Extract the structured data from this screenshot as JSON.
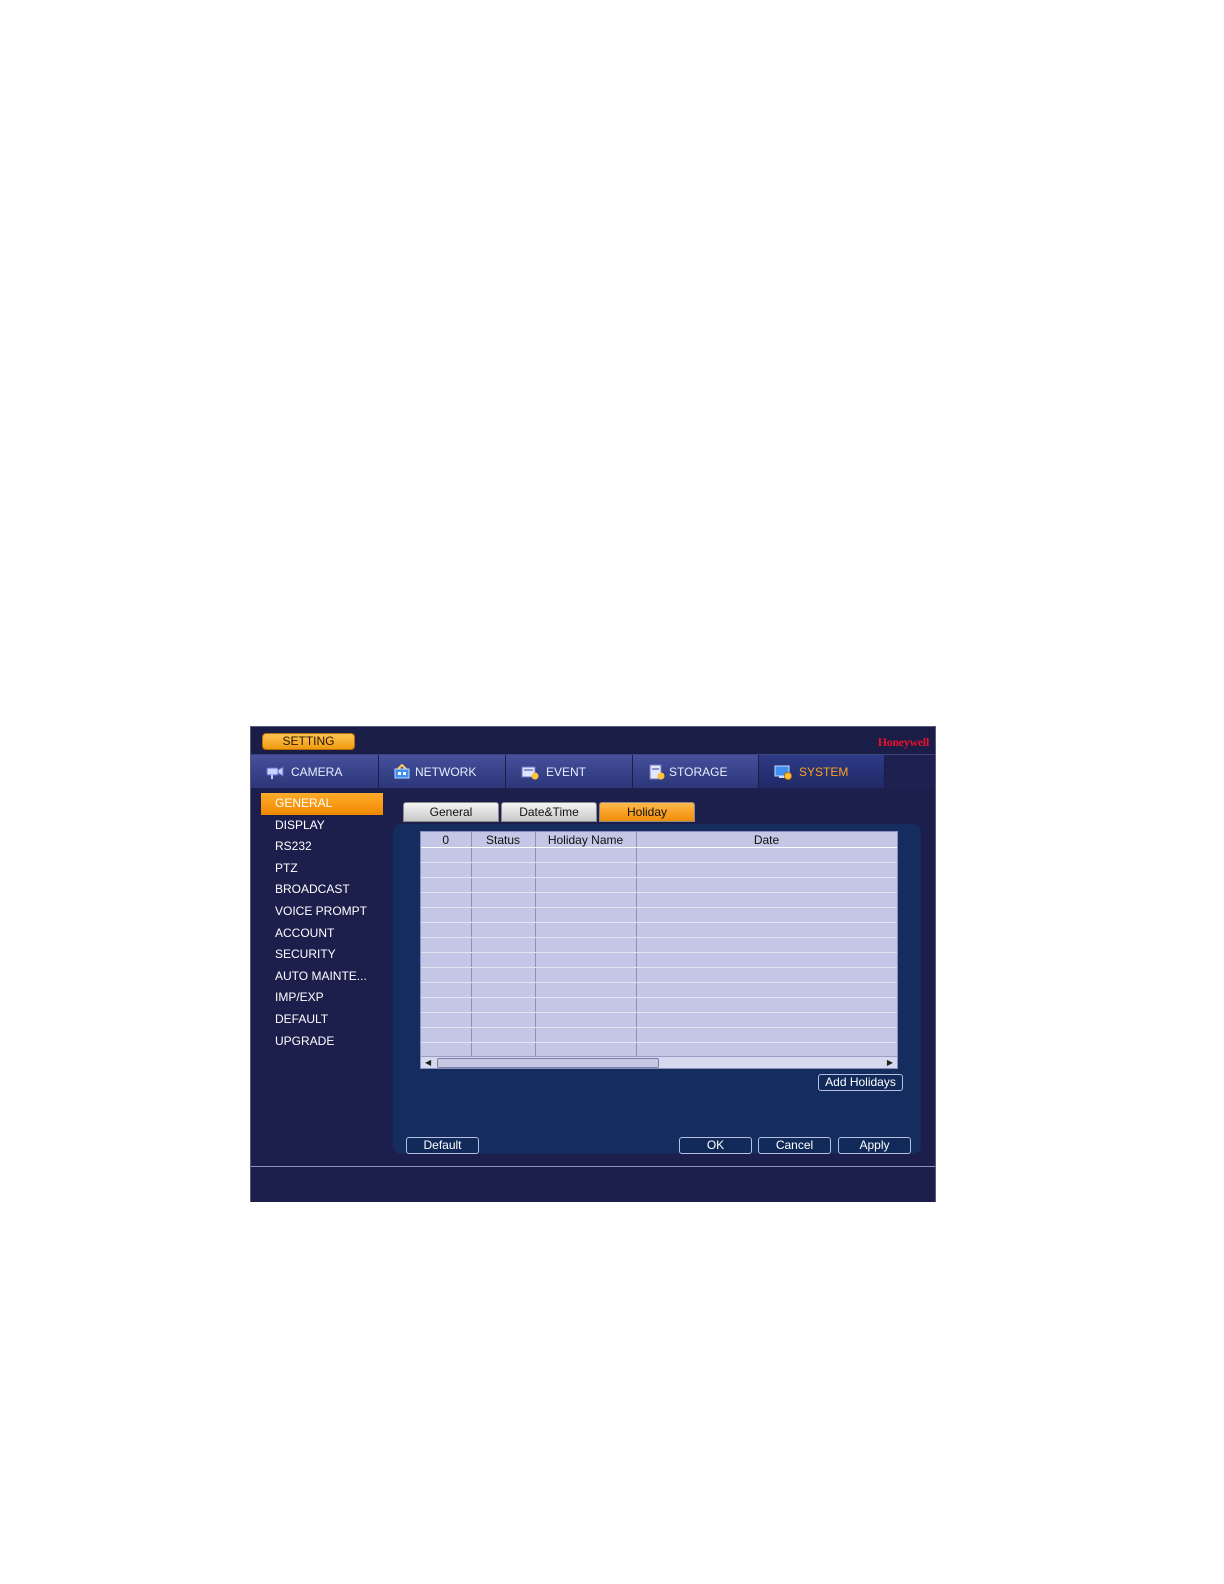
{
  "titlebar": {
    "setting_label": "SETTING",
    "brand": "Honeywell"
  },
  "main_tabs": [
    {
      "label": "CAMERA",
      "icon": "camera-icon"
    },
    {
      "label": "NETWORK",
      "icon": "network-icon"
    },
    {
      "label": "EVENT",
      "icon": "event-icon"
    },
    {
      "label": "STORAGE",
      "icon": "storage-icon"
    },
    {
      "label": "SYSTEM",
      "icon": "system-icon"
    }
  ],
  "sidebar": {
    "items": [
      {
        "label": "GENERAL"
      },
      {
        "label": "DISPLAY"
      },
      {
        "label": "RS232"
      },
      {
        "label": "PTZ"
      },
      {
        "label": "BROADCAST"
      },
      {
        "label": "VOICE PROMPT"
      },
      {
        "label": "ACCOUNT"
      },
      {
        "label": "SECURITY"
      },
      {
        "label": "AUTO MAINTE..."
      },
      {
        "label": "IMP/EXP"
      },
      {
        "label": "DEFAULT"
      },
      {
        "label": "UPGRADE"
      }
    ]
  },
  "sub_tabs": [
    {
      "label": "General"
    },
    {
      "label": "Date&Time"
    },
    {
      "label": "Holiday"
    }
  ],
  "holiday_table": {
    "headers": [
      "0",
      "Status",
      "Holiday Name",
      "Date"
    ]
  },
  "buttons": {
    "add_holidays": "Add Holidays",
    "default": "Default",
    "ok": "OK",
    "cancel": "Cancel",
    "apply": "Apply"
  },
  "colors": {
    "accent": "#f7a21b",
    "panel": "#142c5e",
    "background": "#1c1f4c"
  }
}
